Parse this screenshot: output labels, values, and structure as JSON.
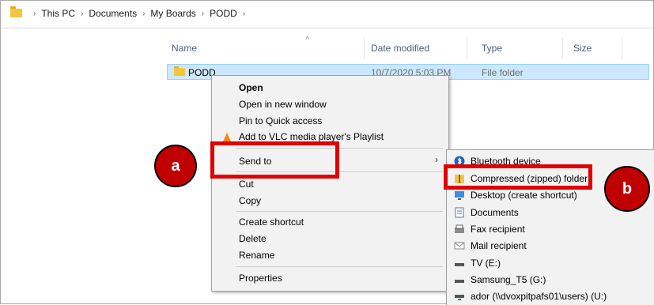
{
  "breadcrumb": [
    "This PC",
    "Documents",
    "My Boards",
    "PODD"
  ],
  "columns": {
    "name": "Name",
    "date": "Date modified",
    "type": "Type",
    "size": "Size"
  },
  "row": {
    "name": "PODD",
    "date": "10/7/2020 5:03 PM",
    "type": "File folder"
  },
  "context_menu": {
    "open": "Open",
    "open_new_window": "Open in new window",
    "pin_quick_access": "Pin to Quick access",
    "vlc_playlist": "Add to VLC media player's Playlist",
    "send_to": "Send to",
    "cut": "Cut",
    "copy": "Copy",
    "create_shortcut": "Create shortcut",
    "delete": "Delete",
    "rename": "Rename",
    "properties": "Properties"
  },
  "send_to_menu": {
    "bluetooth": "Bluetooth device",
    "compressed": "Compressed (zipped) folder",
    "desktop": "Desktop (create shortcut)",
    "documents": "Documents",
    "fax": "Fax recipient",
    "mail": "Mail recipient",
    "tv": "TV (E:)",
    "samsung": "Samsung_T5 (G:)",
    "ador": "ador (\\\\dvoxpitpafs01\\users) (U:)"
  },
  "annotations": {
    "a": "a",
    "b": "b"
  },
  "colors": {
    "highlight": "#e00000",
    "circle": "#c00000",
    "selection": "#cce8ff"
  }
}
